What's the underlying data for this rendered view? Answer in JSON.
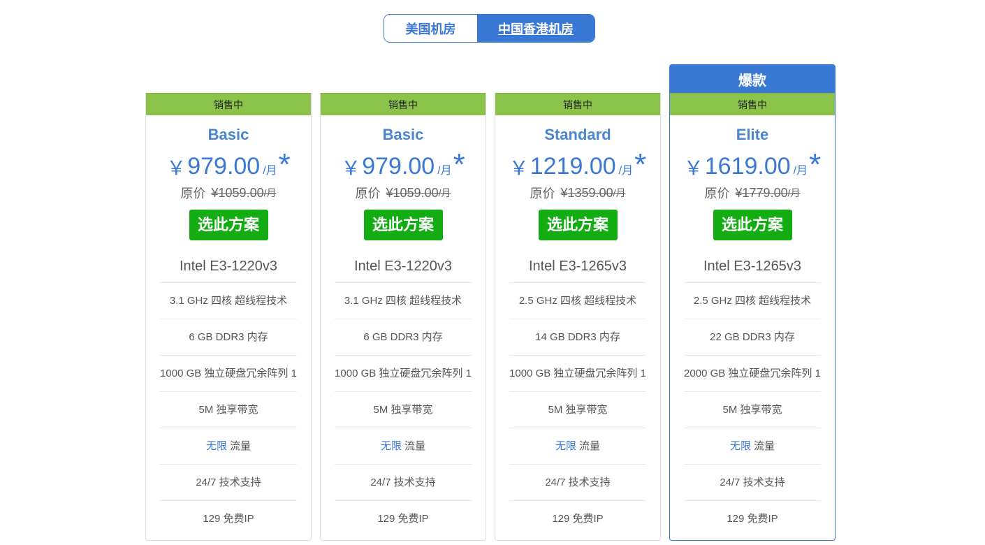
{
  "tabs": {
    "us_label": "美国机房",
    "hk_label": "中国香港机房",
    "active": "中国香港机房"
  },
  "hot_label": "爆款",
  "plans": [
    {
      "status": "销售中",
      "name": "Basic",
      "currency": "￥",
      "price": "979.00",
      "unit": "/月",
      "star": "*",
      "orig_label": "原价",
      "orig_price": "¥1059.00",
      "orig_unit": "/月",
      "button": "选此方案",
      "cpu": "Intel E3-1220v3",
      "specs": [
        "3.1 GHz 四核 超线程技术",
        "6 GB DDR3 内存",
        "1000 GB 独立硬盘冗余阵列 1",
        "5M 独享带宽"
      ],
      "traffic_highlight": "无限",
      "traffic_label": "流量",
      "support": "24/7 技术支持",
      "ips": "129 免费IP"
    },
    {
      "status": "销售中",
      "name": "Basic",
      "currency": "￥",
      "price": "979.00",
      "unit": "/月",
      "star": "*",
      "orig_label": "原价",
      "orig_price": "¥1059.00",
      "orig_unit": "/月",
      "button": "选此方案",
      "cpu": "Intel E3-1220v3",
      "specs": [
        "3.1 GHz 四核 超线程技术",
        "6 GB DDR3 内存",
        "1000 GB 独立硬盘冗余阵列 1",
        "5M 独享带宽"
      ],
      "traffic_highlight": "无限",
      "traffic_label": "流量",
      "support": "24/7 技术支持",
      "ips": "129 免费IP"
    },
    {
      "status": "销售中",
      "name": "Standard",
      "currency": "￥",
      "price": "1219.00",
      "unit": "/月",
      "star": "*",
      "orig_label": "原价",
      "orig_price": "¥1359.00",
      "orig_unit": "/月",
      "button": "选此方案",
      "cpu": "Intel E3-1265v3",
      "specs": [
        "2.5 GHz 四核 超线程技术",
        "14 GB DDR3 内存",
        "1000 GB 独立硬盘冗余阵列 1",
        "5M 独享带宽"
      ],
      "traffic_highlight": "无限",
      "traffic_label": "流量",
      "support": "24/7 技术支持",
      "ips": "129 免费IP"
    },
    {
      "status": "销售中",
      "name": "Elite",
      "currency": "￥",
      "price": "1619.00",
      "unit": "/月",
      "star": "*",
      "orig_label": "原价",
      "orig_price": "¥1779.00",
      "orig_unit": "/月",
      "button": "选此方案",
      "cpu": "Intel E3-1265v3",
      "specs": [
        "2.5 GHz 四核 超线程技术",
        "22 GB DDR3 内存",
        "2000 GB 独立硬盘冗余阵列 1",
        "5M 独享带宽"
      ],
      "traffic_highlight": "无限",
      "traffic_label": "流量",
      "support": "24/7 技术支持",
      "ips": "129 免费IP"
    }
  ],
  "colors": {
    "accent": "#3a78d6",
    "status_green": "#8bc34a",
    "button_green": "#13ac13"
  }
}
